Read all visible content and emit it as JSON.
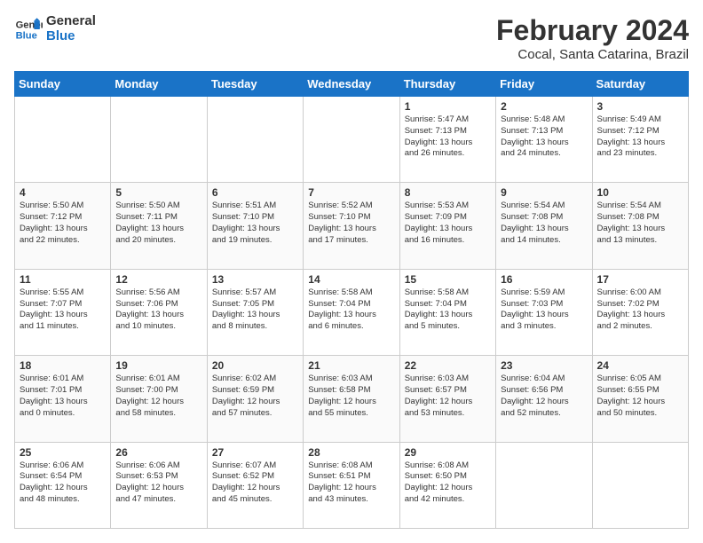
{
  "logo": {
    "line1": "General",
    "line2": "Blue"
  },
  "header": {
    "month": "February 2024",
    "location": "Cocal, Santa Catarina, Brazil"
  },
  "days": [
    "Sunday",
    "Monday",
    "Tuesday",
    "Wednesday",
    "Thursday",
    "Friday",
    "Saturday"
  ],
  "weeks": [
    [
      {
        "num": "",
        "text": ""
      },
      {
        "num": "",
        "text": ""
      },
      {
        "num": "",
        "text": ""
      },
      {
        "num": "",
        "text": ""
      },
      {
        "num": "1",
        "text": "Sunrise: 5:47 AM\nSunset: 7:13 PM\nDaylight: 13 hours\nand 26 minutes."
      },
      {
        "num": "2",
        "text": "Sunrise: 5:48 AM\nSunset: 7:13 PM\nDaylight: 13 hours\nand 24 minutes."
      },
      {
        "num": "3",
        "text": "Sunrise: 5:49 AM\nSunset: 7:12 PM\nDaylight: 13 hours\nand 23 minutes."
      }
    ],
    [
      {
        "num": "4",
        "text": "Sunrise: 5:50 AM\nSunset: 7:12 PM\nDaylight: 13 hours\nand 22 minutes."
      },
      {
        "num": "5",
        "text": "Sunrise: 5:50 AM\nSunset: 7:11 PM\nDaylight: 13 hours\nand 20 minutes."
      },
      {
        "num": "6",
        "text": "Sunrise: 5:51 AM\nSunset: 7:10 PM\nDaylight: 13 hours\nand 19 minutes."
      },
      {
        "num": "7",
        "text": "Sunrise: 5:52 AM\nSunset: 7:10 PM\nDaylight: 13 hours\nand 17 minutes."
      },
      {
        "num": "8",
        "text": "Sunrise: 5:53 AM\nSunset: 7:09 PM\nDaylight: 13 hours\nand 16 minutes."
      },
      {
        "num": "9",
        "text": "Sunrise: 5:54 AM\nSunset: 7:08 PM\nDaylight: 13 hours\nand 14 minutes."
      },
      {
        "num": "10",
        "text": "Sunrise: 5:54 AM\nSunset: 7:08 PM\nDaylight: 13 hours\nand 13 minutes."
      }
    ],
    [
      {
        "num": "11",
        "text": "Sunrise: 5:55 AM\nSunset: 7:07 PM\nDaylight: 13 hours\nand 11 minutes."
      },
      {
        "num": "12",
        "text": "Sunrise: 5:56 AM\nSunset: 7:06 PM\nDaylight: 13 hours\nand 10 minutes."
      },
      {
        "num": "13",
        "text": "Sunrise: 5:57 AM\nSunset: 7:05 PM\nDaylight: 13 hours\nand 8 minutes."
      },
      {
        "num": "14",
        "text": "Sunrise: 5:58 AM\nSunset: 7:04 PM\nDaylight: 13 hours\nand 6 minutes."
      },
      {
        "num": "15",
        "text": "Sunrise: 5:58 AM\nSunset: 7:04 PM\nDaylight: 13 hours\nand 5 minutes."
      },
      {
        "num": "16",
        "text": "Sunrise: 5:59 AM\nSunset: 7:03 PM\nDaylight: 13 hours\nand 3 minutes."
      },
      {
        "num": "17",
        "text": "Sunrise: 6:00 AM\nSunset: 7:02 PM\nDaylight: 13 hours\nand 2 minutes."
      }
    ],
    [
      {
        "num": "18",
        "text": "Sunrise: 6:01 AM\nSunset: 7:01 PM\nDaylight: 13 hours\nand 0 minutes."
      },
      {
        "num": "19",
        "text": "Sunrise: 6:01 AM\nSunset: 7:00 PM\nDaylight: 12 hours\nand 58 minutes."
      },
      {
        "num": "20",
        "text": "Sunrise: 6:02 AM\nSunset: 6:59 PM\nDaylight: 12 hours\nand 57 minutes."
      },
      {
        "num": "21",
        "text": "Sunrise: 6:03 AM\nSunset: 6:58 PM\nDaylight: 12 hours\nand 55 minutes."
      },
      {
        "num": "22",
        "text": "Sunrise: 6:03 AM\nSunset: 6:57 PM\nDaylight: 12 hours\nand 53 minutes."
      },
      {
        "num": "23",
        "text": "Sunrise: 6:04 AM\nSunset: 6:56 PM\nDaylight: 12 hours\nand 52 minutes."
      },
      {
        "num": "24",
        "text": "Sunrise: 6:05 AM\nSunset: 6:55 PM\nDaylight: 12 hours\nand 50 minutes."
      }
    ],
    [
      {
        "num": "25",
        "text": "Sunrise: 6:06 AM\nSunset: 6:54 PM\nDaylight: 12 hours\nand 48 minutes."
      },
      {
        "num": "26",
        "text": "Sunrise: 6:06 AM\nSunset: 6:53 PM\nDaylight: 12 hours\nand 47 minutes."
      },
      {
        "num": "27",
        "text": "Sunrise: 6:07 AM\nSunset: 6:52 PM\nDaylight: 12 hours\nand 45 minutes."
      },
      {
        "num": "28",
        "text": "Sunrise: 6:08 AM\nSunset: 6:51 PM\nDaylight: 12 hours\nand 43 minutes."
      },
      {
        "num": "29",
        "text": "Sunrise: 6:08 AM\nSunset: 6:50 PM\nDaylight: 12 hours\nand 42 minutes."
      },
      {
        "num": "",
        "text": ""
      },
      {
        "num": "",
        "text": ""
      }
    ]
  ]
}
